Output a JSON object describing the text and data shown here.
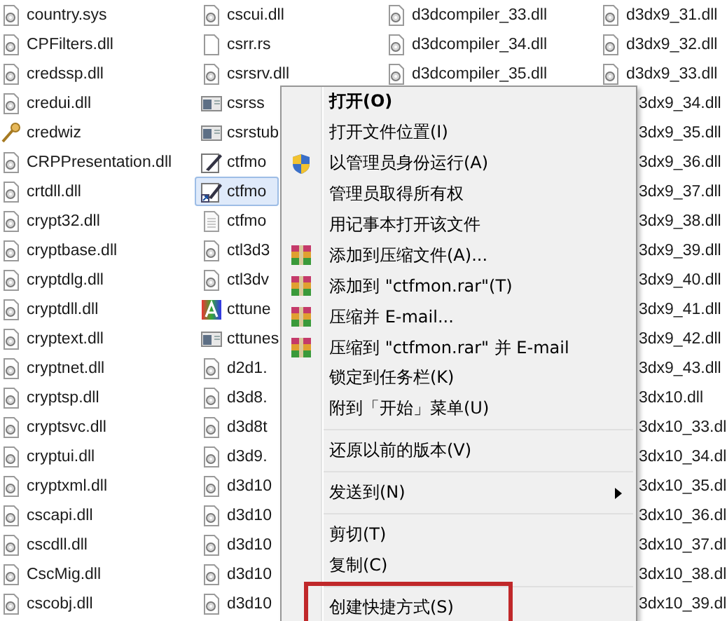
{
  "columns": [
    {
      "files": [
        {
          "name": "country.sys",
          "kind": "dll",
          "selected": false
        },
        {
          "name": "CPFilters.dll",
          "kind": "dll",
          "selected": false
        },
        {
          "name": "credssp.dll",
          "kind": "dll",
          "selected": false
        },
        {
          "name": "credui.dll",
          "kind": "dll",
          "selected": false
        },
        {
          "name": "credwiz",
          "kind": "key",
          "selected": false
        },
        {
          "name": "CRPPresentation.dll",
          "kind": "dll",
          "selected": false
        },
        {
          "name": "crtdll.dll",
          "kind": "dll",
          "selected": false
        },
        {
          "name": "crypt32.dll",
          "kind": "dll",
          "selected": false
        },
        {
          "name": "cryptbase.dll",
          "kind": "dll",
          "selected": false
        },
        {
          "name": "cryptdlg.dll",
          "kind": "dll",
          "selected": false
        },
        {
          "name": "cryptdll.dll",
          "kind": "dll",
          "selected": false
        },
        {
          "name": "cryptext.dll",
          "kind": "dll",
          "selected": false
        },
        {
          "name": "cryptnet.dll",
          "kind": "dll",
          "selected": false
        },
        {
          "name": "cryptsp.dll",
          "kind": "dll",
          "selected": false
        },
        {
          "name": "cryptsvc.dll",
          "kind": "dll",
          "selected": false
        },
        {
          "name": "cryptui.dll",
          "kind": "dll",
          "selected": false
        },
        {
          "name": "cryptxml.dll",
          "kind": "dll",
          "selected": false
        },
        {
          "name": "cscapi.dll",
          "kind": "dll",
          "selected": false
        },
        {
          "name": "cscdll.dll",
          "kind": "dll",
          "selected": false
        },
        {
          "name": "CscMig.dll",
          "kind": "dll",
          "selected": false
        },
        {
          "name": "cscobj.dll",
          "kind": "dll",
          "selected": false
        }
      ]
    },
    {
      "files": [
        {
          "name": "cscui.dll",
          "kind": "dll",
          "selected": false
        },
        {
          "name": "csrr.rs",
          "kind": "blank",
          "selected": false
        },
        {
          "name": "csrsrv.dll",
          "kind": "dll",
          "selected": false
        },
        {
          "name": "csrss",
          "kind": "app",
          "selected": false
        },
        {
          "name": "csrstub",
          "kind": "app",
          "selected": false
        },
        {
          "name": "ctfmo",
          "kind": "pen",
          "selected": false
        },
        {
          "name": "ctfmo",
          "kind": "shortcut",
          "selected": true
        },
        {
          "name": "ctfmo",
          "kind": "text",
          "selected": false
        },
        {
          "name": "ctl3d3",
          "kind": "dll",
          "selected": false
        },
        {
          "name": "ctl3dv",
          "kind": "dll",
          "selected": false
        },
        {
          "name": "cttune",
          "kind": "font",
          "selected": false
        },
        {
          "name": "cttunes",
          "kind": "app",
          "selected": false
        },
        {
          "name": "d2d1.",
          "kind": "dll",
          "selected": false
        },
        {
          "name": "d3d8.",
          "kind": "dll",
          "selected": false
        },
        {
          "name": "d3d8t",
          "kind": "dll",
          "selected": false
        },
        {
          "name": "d3d9.",
          "kind": "dll",
          "selected": false
        },
        {
          "name": "d3d10",
          "kind": "dll",
          "selected": false
        },
        {
          "name": "d3d10",
          "kind": "dll",
          "selected": false
        },
        {
          "name": "d3d10",
          "kind": "dll",
          "selected": false
        },
        {
          "name": "d3d10",
          "kind": "dll",
          "selected": false
        },
        {
          "name": "d3d10",
          "kind": "dll",
          "selected": false
        }
      ]
    },
    {
      "files": [
        {
          "name": "d3dcompiler_33.dll",
          "kind": "dll",
          "selected": false
        },
        {
          "name": "d3dcompiler_34.dll",
          "kind": "dll",
          "selected": false
        },
        {
          "name": "d3dcompiler_35.dll",
          "kind": "dll",
          "selected": false
        }
      ]
    },
    {
      "files": [
        {
          "name": "d3dx9_31.dll",
          "kind": "dll",
          "selected": false
        },
        {
          "name": "d3dx9_32.dll",
          "kind": "dll",
          "selected": false
        },
        {
          "name": "d3dx9_33.dll",
          "kind": "dll",
          "selected": false
        },
        {
          "name": "3dx9_34.dll",
          "kind": "covered",
          "selected": false
        },
        {
          "name": "3dx9_35.dll",
          "kind": "covered",
          "selected": false
        },
        {
          "name": "3dx9_36.dll",
          "kind": "covered",
          "selected": false
        },
        {
          "name": "3dx9_37.dll",
          "kind": "covered",
          "selected": false
        },
        {
          "name": "3dx9_38.dll",
          "kind": "covered",
          "selected": false
        },
        {
          "name": "3dx9_39.dll",
          "kind": "covered",
          "selected": false
        },
        {
          "name": "3dx9_40.dll",
          "kind": "covered",
          "selected": false
        },
        {
          "name": "3dx9_41.dll",
          "kind": "covered",
          "selected": false
        },
        {
          "name": "3dx9_42.dll",
          "kind": "covered",
          "selected": false
        },
        {
          "name": "3dx9_43.dll",
          "kind": "covered",
          "selected": false
        },
        {
          "name": "3dx10.dll",
          "kind": "covered",
          "selected": false
        },
        {
          "name": "3dx10_33.dl",
          "kind": "covered",
          "selected": false
        },
        {
          "name": "3dx10_34.dl",
          "kind": "covered",
          "selected": false
        },
        {
          "name": "3dx10_35.dl",
          "kind": "covered",
          "selected": false
        },
        {
          "name": "3dx10_36.dl",
          "kind": "covered",
          "selected": false
        },
        {
          "name": "3dx10_37.dl",
          "kind": "covered",
          "selected": false
        },
        {
          "name": "3dx10_38.dl",
          "kind": "covered",
          "selected": false
        },
        {
          "name": "3dx10_39.dl",
          "kind": "covered",
          "selected": false
        }
      ]
    }
  ],
  "context_menu": {
    "items": [
      {
        "kind": "plain",
        "label": "打开(O)",
        "bold": true
      },
      {
        "kind": "plain",
        "label": "打开文件位置(I)"
      },
      {
        "kind": "admin",
        "label": "以管理员身份运行(A)"
      },
      {
        "kind": "plain",
        "label": "管理员取得所有权"
      },
      {
        "kind": "plain",
        "label": "用记事本打开该文件"
      },
      {
        "kind": "archive",
        "label": "添加到压缩文件(A)..."
      },
      {
        "kind": "archive",
        "label": "添加到 \"ctfmon.rar\"(T)"
      },
      {
        "kind": "archive",
        "label": "压缩并 E-mail..."
      },
      {
        "kind": "archive",
        "label": "压缩到 \"ctfmon.rar\" 并 E-mail"
      },
      {
        "kind": "plain",
        "label": "锁定到任务栏(K)"
      },
      {
        "kind": "plain",
        "label": "附到「开始」菜单(U)"
      },
      {
        "kind": "separator"
      },
      {
        "kind": "plain",
        "label": "还原以前的版本(V)"
      },
      {
        "kind": "separator"
      },
      {
        "kind": "plain",
        "label": "发送到(N)",
        "submenu": true
      },
      {
        "kind": "separator"
      },
      {
        "kind": "plain",
        "label": "剪切(T)"
      },
      {
        "kind": "plain",
        "label": "复制(C)"
      },
      {
        "kind": "separator"
      },
      {
        "kind": "plain",
        "label": "创建快捷方式(S)",
        "marked": true
      }
    ]
  }
}
